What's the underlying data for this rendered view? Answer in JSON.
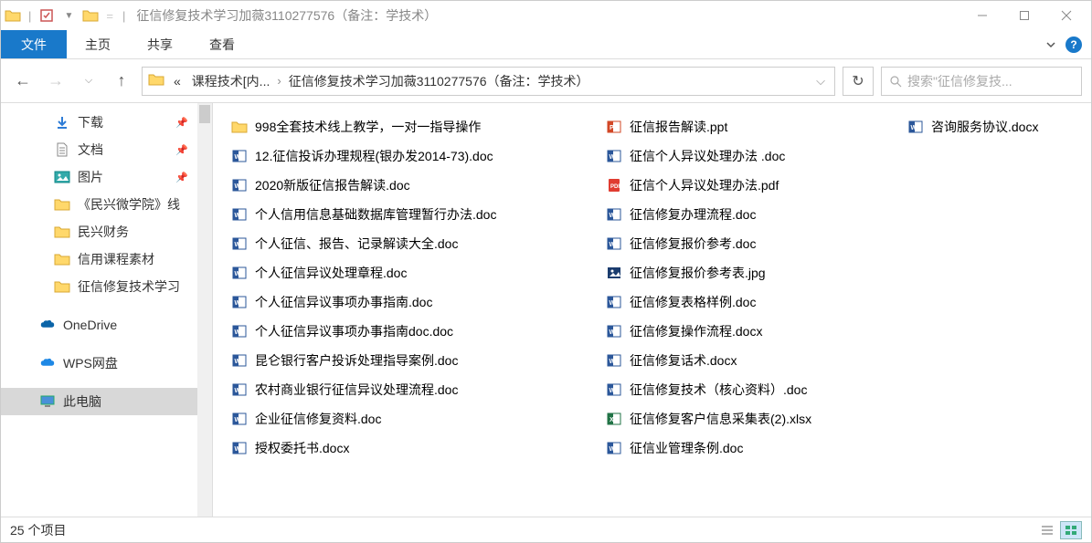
{
  "window": {
    "title": "征信修复技术学习加薇3110277576（备注：学技术）"
  },
  "ribbon": {
    "file": "文件",
    "home": "主页",
    "share": "共享",
    "view": "查看"
  },
  "address": {
    "crumb1_prefix": "«",
    "crumb1": "课程技术[内...",
    "crumb2": "征信修复技术学习加薇3110277576（备注：学技术）",
    "search_placeholder": "搜索\"征信修复技..."
  },
  "sidebar": {
    "items": [
      {
        "icon": "download",
        "label": "下载",
        "pinned": true,
        "indent": true
      },
      {
        "icon": "document",
        "label": "文档",
        "pinned": true,
        "indent": true
      },
      {
        "icon": "pictures",
        "label": "图片",
        "pinned": true,
        "indent": true
      },
      {
        "icon": "folder",
        "label": "《民兴微学院》线",
        "indent": true
      },
      {
        "icon": "folder",
        "label": "民兴财务",
        "indent": true
      },
      {
        "icon": "folder",
        "label": "信用课程素材",
        "indent": true
      },
      {
        "icon": "folder",
        "label": "征信修复技术学习",
        "indent": true
      },
      {
        "icon": "gap"
      },
      {
        "icon": "onedrive",
        "label": "OneDrive"
      },
      {
        "icon": "gap"
      },
      {
        "icon": "wps",
        "label": "WPS网盘"
      },
      {
        "icon": "gap"
      },
      {
        "icon": "thispc",
        "label": "此电脑",
        "selected": true
      }
    ]
  },
  "files": {
    "col1": [
      {
        "icon": "folder",
        "name": "998全套技术线上教学，一对一指导操作"
      },
      {
        "icon": "word",
        "name": "12.征信投诉办理规程(银办发2014-73).doc"
      },
      {
        "icon": "word",
        "name": "2020新版征信报告解读.doc"
      },
      {
        "icon": "word",
        "name": "个人信用信息基础数据库管理暂行办法.doc"
      },
      {
        "icon": "word",
        "name": "个人征信、报告、记录解读大全.doc"
      },
      {
        "icon": "word",
        "name": "个人征信异议处理章程.doc"
      },
      {
        "icon": "word",
        "name": "个人征信异议事项办事指南.doc"
      },
      {
        "icon": "word",
        "name": "个人征信异议事项办事指南doc.doc"
      },
      {
        "icon": "word",
        "name": "昆仑银行客户投诉处理指导案例.doc"
      },
      {
        "icon": "word",
        "name": "农村商业银行征信异议处理流程.doc"
      },
      {
        "icon": "word",
        "name": "企业征信修复资料.doc"
      },
      {
        "icon": "wordx",
        "name": "授权委托书.docx"
      }
    ],
    "col2": [
      {
        "icon": "ppt",
        "name": "征信报告解读.ppt"
      },
      {
        "icon": "word",
        "name": "征信个人异议处理办法 .doc"
      },
      {
        "icon": "pdf",
        "name": "征信个人异议处理办法.pdf"
      },
      {
        "icon": "word",
        "name": "征信修复办理流程.doc"
      },
      {
        "icon": "word",
        "name": "征信修复报价参考.doc"
      },
      {
        "icon": "jpg",
        "name": "征信修复报价参考表.jpg"
      },
      {
        "icon": "word",
        "name": "征信修复表格样例.doc"
      },
      {
        "icon": "wordx",
        "name": "征信修复操作流程.docx"
      },
      {
        "icon": "wordx",
        "name": "征信修复话术.docx"
      },
      {
        "icon": "word",
        "name": "征信修复技术（核心资料）.doc"
      },
      {
        "icon": "xlsx",
        "name": "征信修复客户信息采集表(2).xlsx"
      },
      {
        "icon": "word",
        "name": "征信业管理条例.doc"
      }
    ],
    "col3": [
      {
        "icon": "wordx",
        "name": "咨询服务协议.docx"
      }
    ]
  },
  "status": {
    "count": "25 个项目"
  }
}
